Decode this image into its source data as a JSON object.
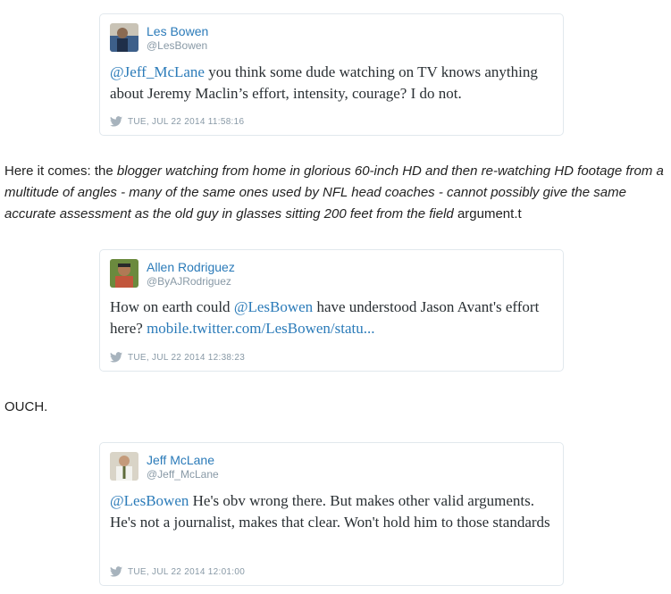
{
  "tweets": [
    {
      "name": "Les Bowen",
      "handle": "@LesBowen",
      "mention": "@Jeff_McLane",
      "text": " you think some dude watching on TV knows anything about Jeremy Maclin’s effort, intensity, courage? I do not.",
      "timestamp": "TUE, JUL 22 2014 11:58:16",
      "avatar_colors": [
        "#3d5f8a",
        "#c9c3b6"
      ]
    },
    {
      "name": "Allen Rodriguez",
      "handle": "@ByAJRodriguez",
      "text_before": "How on earth could ",
      "mention": "@LesBowen",
      "text_after": " have understood Jason Avant's effort here? ",
      "link": "mobile.twitter.com/LesBowen/statu...",
      "timestamp": "TUE, JUL 22 2014 12:38:23",
      "avatar_colors": [
        "#6b8a3e",
        "#c2563c"
      ]
    },
    {
      "name": "Jeff McLane",
      "handle": "@Jeff_McLane",
      "mention": "@LesBowen",
      "text": " He's obv wrong there. But makes other valid arguments. He's not a journalist, makes that clear. Won't hold him to those standards",
      "timestamp": "TUE, JUL 22 2014 12:01:00",
      "avatar_colors": [
        "#d9d4c7",
        "#5e6b3a"
      ]
    }
  ],
  "prose": {
    "p1_start": "Here it comes: the ",
    "p1_italic": "blogger watching from home in glorious 60-inch HD and then re-watching HD footage from a multitude of angles - many of the same ones used by NFL head coaches - cannot possibly give the same accurate assessment as the old guy in glasses sitting 200 feet from the field",
    "p1_end": " argument.t",
    "p2": "OUCH."
  },
  "colors": {
    "link": "#2b7bb9",
    "meta": "#8899a6",
    "border": "#e1e8ed"
  }
}
